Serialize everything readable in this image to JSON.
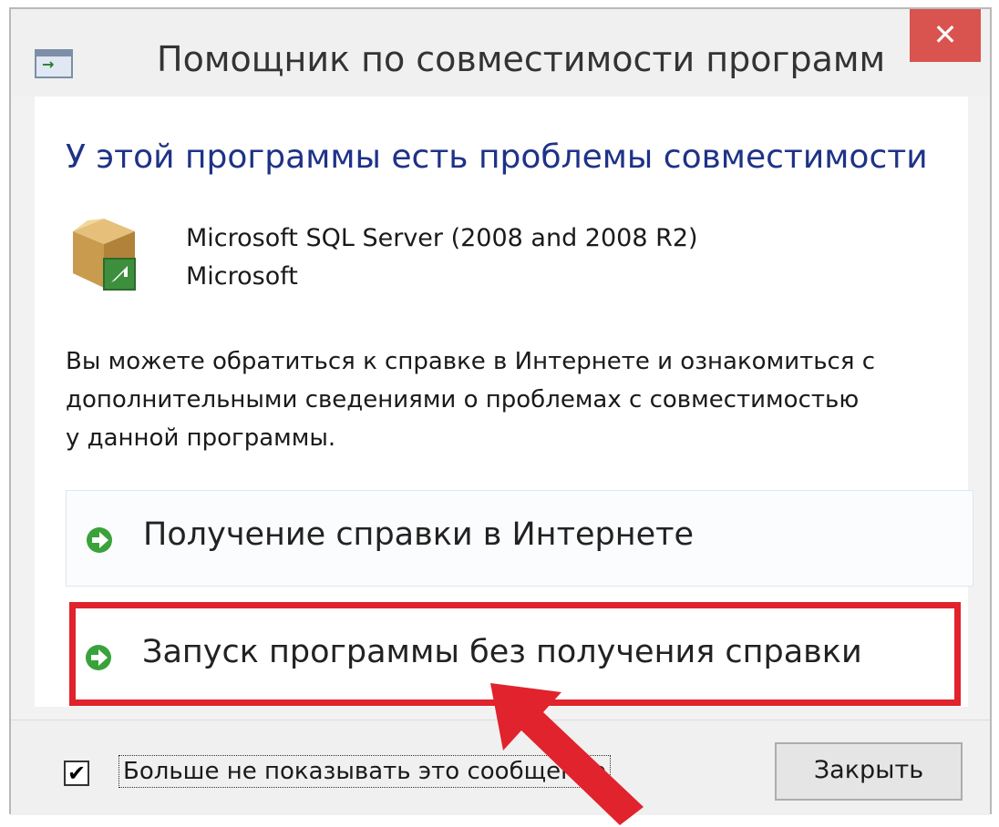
{
  "window": {
    "title": "Помощник по совместимости программ",
    "close_glyph": "✕"
  },
  "content": {
    "heading": "У этой программы есть проблемы совместимости",
    "app_name": "Microsoft SQL Server (2008 and 2008 R2)",
    "app_publisher": "Microsoft",
    "description_lines": [
      "Вы можете обратиться к справке в Интернете и ознакомиться с",
      "дополнительными сведениями о проблемах с совместимостью",
      "у данной программы."
    ]
  },
  "options": [
    {
      "label": "Получение справки в Интернете",
      "icon": "green-arrow-icon"
    },
    {
      "label": "Запуск программы без получения справки",
      "icon": "green-arrow-icon"
    }
  ],
  "footer": {
    "checkbox_label": "Больше не показывать это сообщение",
    "checkbox_checked": true,
    "close_button": "Закрыть"
  },
  "colors": {
    "heading": "#1e3287",
    "highlight": "#e0232c",
    "close": "#d9534f",
    "arrow_green": "#3aa23a"
  }
}
